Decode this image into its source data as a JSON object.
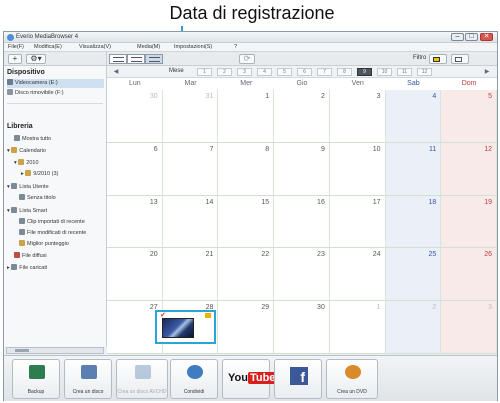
{
  "callout": {
    "label": "Data di registrazione",
    "accent": "#2aa5d8"
  },
  "window": {
    "title": "Everio MediaBrowser 4",
    "controls": {
      "minimize": "–",
      "maximize": "□",
      "close": "✕"
    }
  },
  "menubar": [
    "File(F)",
    "Modifica(E)",
    "Visualizza(V)",
    "Media(M)",
    "Impostazioni(S)",
    "?"
  ],
  "toolbar": {
    "add": "+",
    "filter_label": "Filtro"
  },
  "sidebar": {
    "device_title": "Dispositivo",
    "devices": [
      "Videocamera (E:)",
      "Disco rimovibile (F:)"
    ],
    "library_title": "Libreria",
    "library": [
      {
        "label": "Mostra tutto"
      },
      {
        "label": "Calendario"
      },
      {
        "label": "2010"
      },
      {
        "label": "9/2010 (3)"
      },
      {
        "label": "Lista Utente"
      },
      {
        "label": "Senza titolo"
      },
      {
        "label": "Lista Smart"
      },
      {
        "label": "Clip importati di recente"
      },
      {
        "label": "File modificati di recente"
      },
      {
        "label": "Miglior punteggio"
      },
      {
        "label": "File diffusi"
      },
      {
        "label": "File caricati"
      }
    ]
  },
  "calendar": {
    "month_label": "Mese",
    "months": [
      "1",
      "2",
      "3",
      "4",
      "5",
      "6",
      "7",
      "8",
      "9",
      "10",
      "11",
      "12"
    ],
    "selected_month": "9",
    "days_of_week": [
      "Lun",
      "Mar",
      "Mer",
      "Gio",
      "Ven",
      "Sab",
      "Dom"
    ],
    "weeks": [
      [
        "30",
        "31",
        "1",
        "2",
        "3",
        "4",
        "5"
      ],
      [
        "6",
        "7",
        "8",
        "9",
        "10",
        "11",
        "12"
      ],
      [
        "13",
        "14",
        "15",
        "16",
        "17",
        "18",
        "19"
      ],
      [
        "20",
        "21",
        "22",
        "23",
        "24",
        "25",
        "26"
      ],
      [
        "27",
        "28",
        "29",
        "30",
        "1",
        "2",
        "3"
      ]
    ],
    "colors": {
      "saturday": "#3556a8",
      "sunday": "#c23b3b"
    }
  },
  "bottom": {
    "buttons": [
      "Backup",
      "Crea un disco",
      "Crea un disco AVCHD",
      "Condividi",
      "YouTube",
      "Facebook",
      "Crea un DVD"
    ],
    "youtube_text": "You",
    "youtube_tube": "Tube",
    "facebook_f": "f"
  }
}
